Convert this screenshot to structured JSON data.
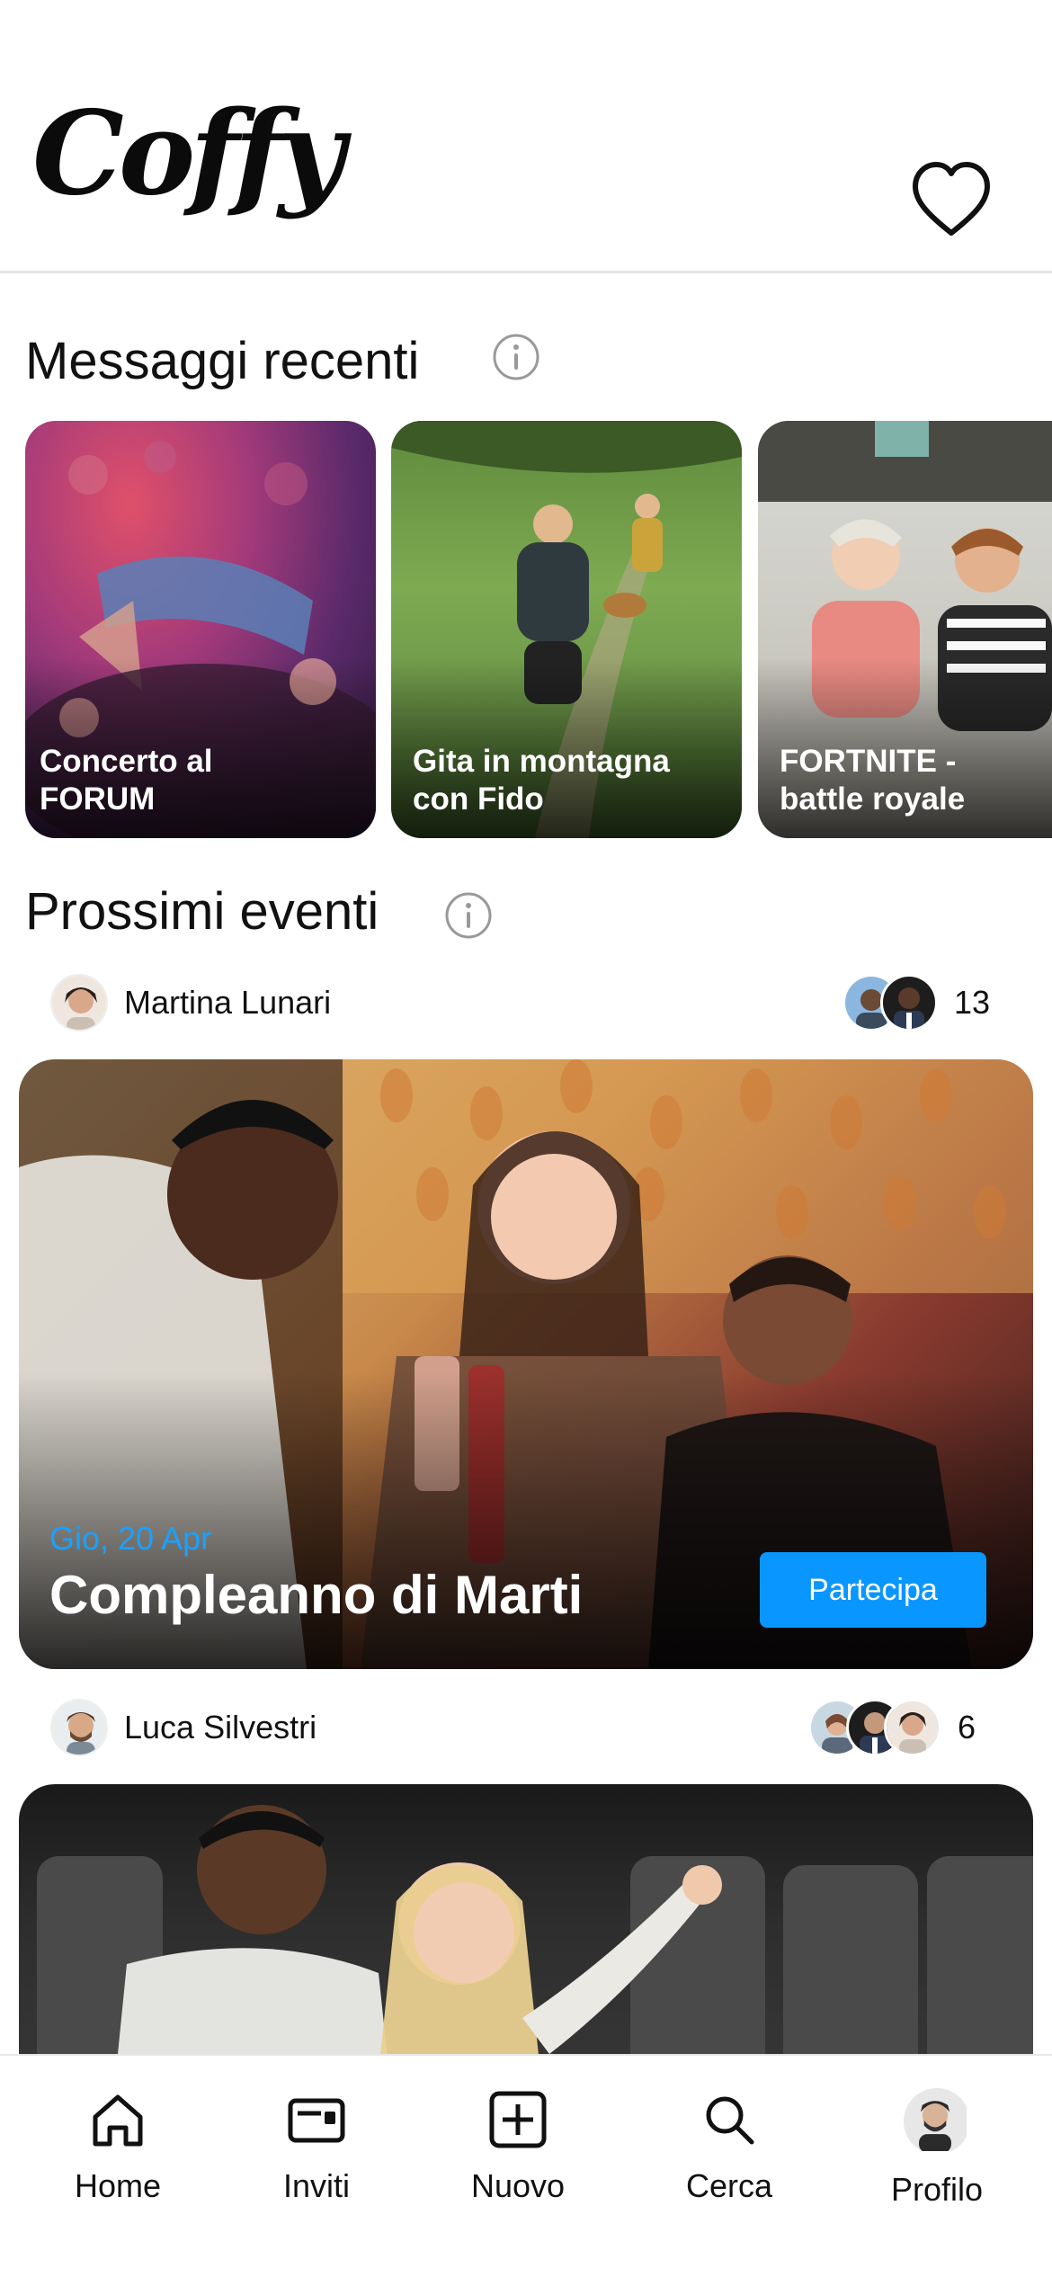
{
  "header": {
    "logo_text": "Coffy"
  },
  "sections": {
    "recent": {
      "title": "Messaggi recenti"
    },
    "upcoming": {
      "title": "Prossimi eventi"
    }
  },
  "recent_chats": [
    {
      "caption": "Concerto al FORUM"
    },
    {
      "caption": "Gita in montagna con Fido"
    },
    {
      "caption": "FORTNITE - battle royale"
    }
  ],
  "events": [
    {
      "organizer": "Martina Lunari",
      "attendee_count": "13",
      "date": "Gio, 20 Apr",
      "title": "Compleanno di Marti",
      "join_label": "Partecipa"
    },
    {
      "organizer": "Luca Silvestri",
      "attendee_count": "6"
    }
  ],
  "tabbar": {
    "home": "Home",
    "invites": "Inviti",
    "new": "Nuovo",
    "search": "Cerca",
    "profile": "Profilo"
  },
  "colors": {
    "accent": "#0a96ff",
    "date": "#1aa1ff"
  },
  "icons": [
    "heart-icon",
    "info-icon",
    "home-icon",
    "ticket-icon",
    "plus-square-icon",
    "search-icon"
  ]
}
